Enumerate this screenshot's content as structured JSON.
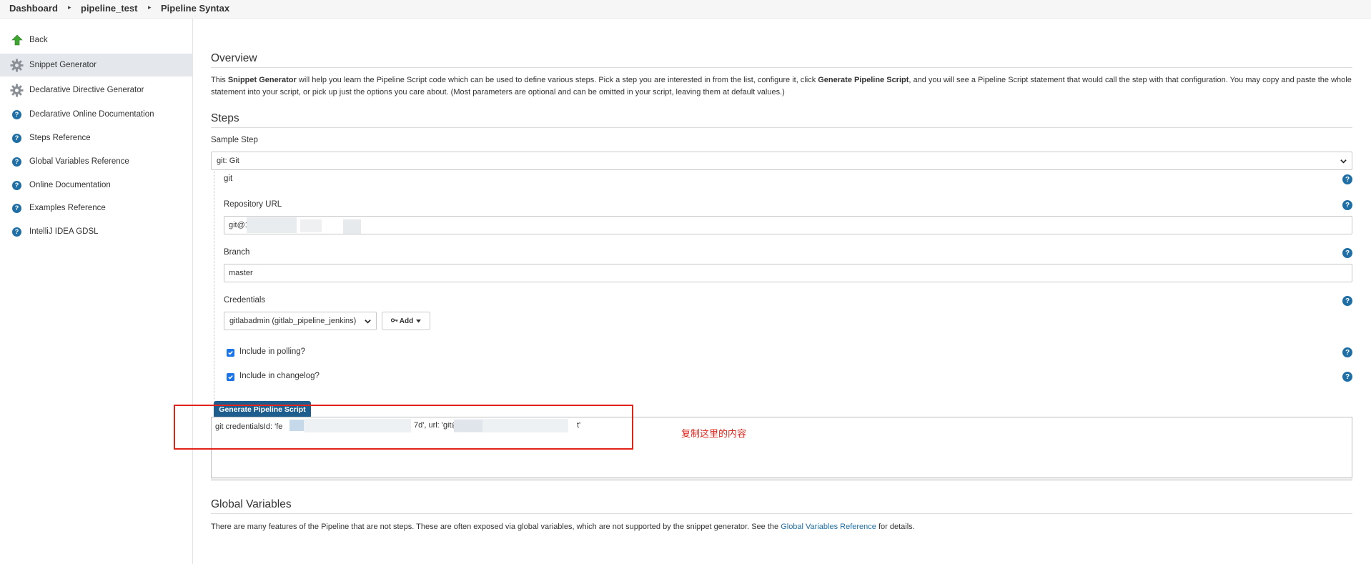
{
  "breadcrumb": {
    "items": [
      "Dashboard",
      "pipeline_test",
      "Pipeline Syntax"
    ],
    "separator": "▸"
  },
  "sidebar": {
    "items": [
      {
        "label": "Back",
        "icon": "arrow-up-icon"
      },
      {
        "label": "Snippet Generator",
        "icon": "gear-icon",
        "active": true
      },
      {
        "label": "Declarative Directive Generator",
        "icon": "gear-icon"
      },
      {
        "label": "Declarative Online Documentation",
        "icon": "help-icon"
      },
      {
        "label": "Steps Reference",
        "icon": "help-icon"
      },
      {
        "label": "Global Variables Reference",
        "icon": "help-icon"
      },
      {
        "label": "Online Documentation",
        "icon": "help-icon"
      },
      {
        "label": "Examples Reference",
        "icon": "help-icon"
      },
      {
        "label": "IntelliJ IDEA GDSL",
        "icon": "help-icon"
      }
    ]
  },
  "overview": {
    "title": "Overview",
    "text_1": "This ",
    "bold_1": "Snippet Generator",
    "text_2": " will help you learn the Pipeline Script code which can be used to define various steps. Pick a step you are interested in from the list, configure it, click ",
    "bold_2": "Generate Pipeline Script",
    "text_3": ", and you will see a Pipeline Script statement that would call the step with that configuration. You may copy and paste the whole statement into your script, or pick up just the options you care about. (Most parameters are optional and can be omitted in your script, leaving them at default values.)"
  },
  "steps": {
    "title": "Steps",
    "sample_step_label": "Sample Step",
    "sample_step_value": "git: Git",
    "step_name": "git",
    "repo_label": "Repository URL",
    "repo_value": "git@1",
    "branch_label": "Branch",
    "branch_value": "master",
    "credentials_label": "Credentials",
    "credentials_value": "gitlabadmin (gitlab_pipeline_jenkins)",
    "add_label": "Add",
    "polling_label": "Include in polling?",
    "changelog_label": "Include in changelog?",
    "generate_label": "Generate Pipeline Script",
    "script_prefix": "git credentialsId: 'fe",
    "script_mid": "7d', url: 'git@",
    "script_end": "t'"
  },
  "annotation": {
    "note": "复制这里的内容",
    "color": "#e2231a"
  },
  "global_vars": {
    "title": "Global Variables",
    "text_1": "There are many features of the Pipeline that are not steps. These are often exposed via global variables, which are not supported by the snippet generator. See the ",
    "link": "Global Variables Reference",
    "text_2": " for details."
  },
  "colors": {
    "accent": "#1f6fa6",
    "button": "#1e5e8e",
    "active_sidebar": "#e4e8ec"
  }
}
